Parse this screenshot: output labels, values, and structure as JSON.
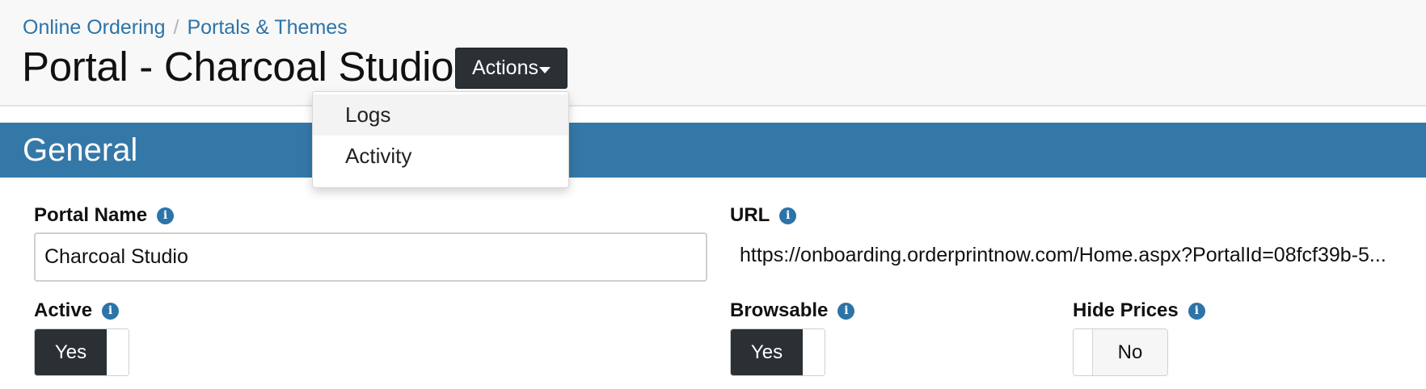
{
  "breadcrumb": {
    "items": [
      "Online Ordering",
      "Portals & Themes"
    ],
    "separator": "/"
  },
  "page_title": "Portal - Charcoal Studio",
  "actions_button": {
    "label": "Actions"
  },
  "actions_menu": {
    "items": [
      "Logs",
      "Activity"
    ],
    "highlighted_item": "Logs"
  },
  "section": {
    "title": "General"
  },
  "fields": {
    "portal_name": {
      "label": "Portal Name",
      "value": "Charcoal Studio"
    },
    "url": {
      "label": "URL",
      "value": "https://onboarding.orderprintnow.com/Home.aspx?PortalId=08fcf39b-5..."
    },
    "active": {
      "label": "Active",
      "value": "Yes"
    },
    "browsable": {
      "label": "Browsable",
      "value": "Yes"
    },
    "hide_prices": {
      "label": "Hide Prices",
      "value": "No"
    }
  },
  "icons": {
    "info": "info-icon",
    "caret": "caret-down-icon"
  },
  "colors": {
    "accent": "#3478a8",
    "link": "#2c74a8",
    "dark_button": "#2b3034"
  }
}
